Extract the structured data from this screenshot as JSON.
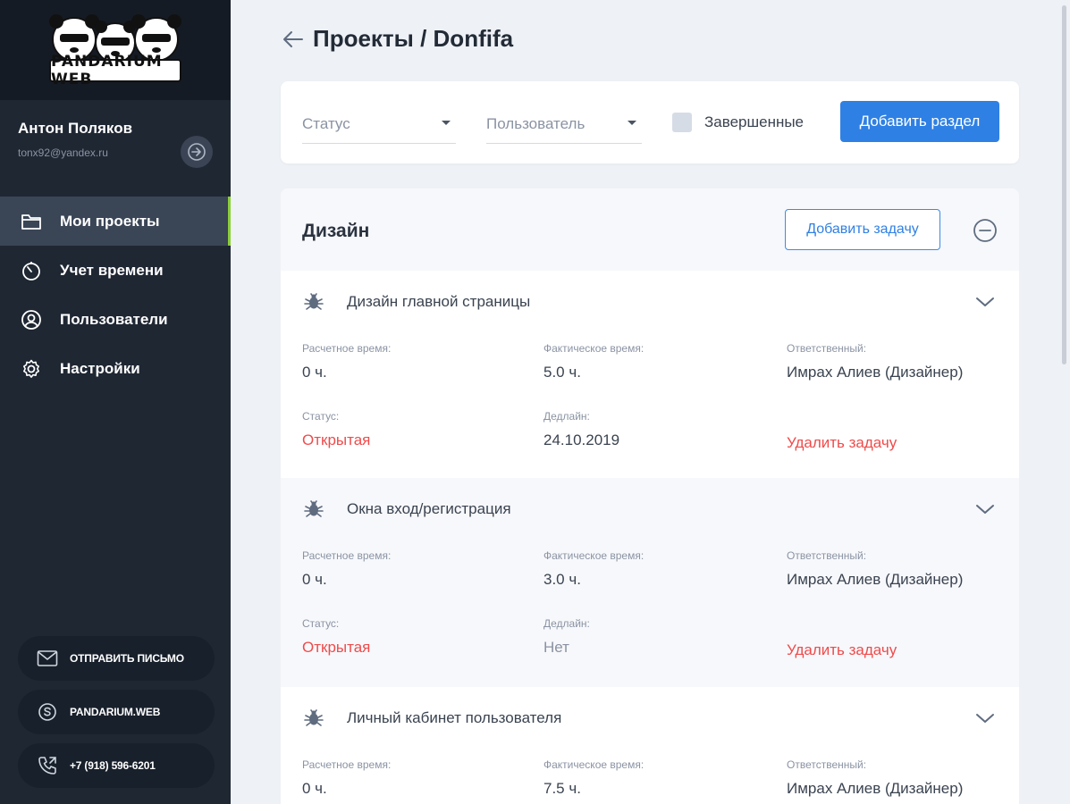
{
  "brand": {
    "logo_text": "PANDARIUM WEB"
  },
  "user": {
    "name": "Антон Поляков",
    "email": "tonx92@yandex.ru"
  },
  "nav": {
    "items": [
      {
        "label": "Мои проекты",
        "icon": "folder-icon",
        "active": true
      },
      {
        "label": "Учет времени",
        "icon": "timer-icon",
        "active": false
      },
      {
        "label": "Пользователи",
        "icon": "user-icon",
        "active": false
      },
      {
        "label": "Настройки",
        "icon": "gear-icon",
        "active": false
      }
    ]
  },
  "contacts": {
    "mail": "ОТПРАВИТЬ ПИСЬМО",
    "skype": "PANDARIUM.WEB",
    "phone": "+7 (918) 596-6201"
  },
  "header": {
    "title": "Проекты / Donfifa"
  },
  "filters": {
    "status_placeholder": "Статус",
    "user_placeholder": "Пользователь",
    "completed_label": "Завершенные",
    "add_section_label": "Добавить раздел"
  },
  "section": {
    "title": "Дизайн",
    "add_task_label": "Добавить задачу"
  },
  "labels": {
    "estimated": "Расчетное время:",
    "actual": "Фактическое время:",
    "responsible": "Ответственный:",
    "status": "Статус:",
    "deadline": "Дедлайн:",
    "delete": "Удалить задачу"
  },
  "tasks": [
    {
      "title": "Дизайн главной страницы",
      "estimated": "0 ч.",
      "actual": "5.0 ч.",
      "responsible": "Имрах Алиев (Дизайнер)",
      "status": "Открытая",
      "deadline": "24.10.2019"
    },
    {
      "title": "Окна вход/регистрация",
      "estimated": "0 ч.",
      "actual": "3.0 ч.",
      "responsible": "Имрах Алиев (Дизайнер)",
      "status": "Открытая",
      "deadline": "Нет"
    },
    {
      "title": "Личный кабинет пользователя",
      "estimated": "0 ч.",
      "actual": "7.5 ч.",
      "responsible": "Имрах Алиев (Дизайнер)"
    }
  ],
  "colors": {
    "sidebar": "#1f2733",
    "accent": "#2f80e4",
    "danger": "#ef4b4b",
    "active_marker": "#8ccf3a"
  }
}
